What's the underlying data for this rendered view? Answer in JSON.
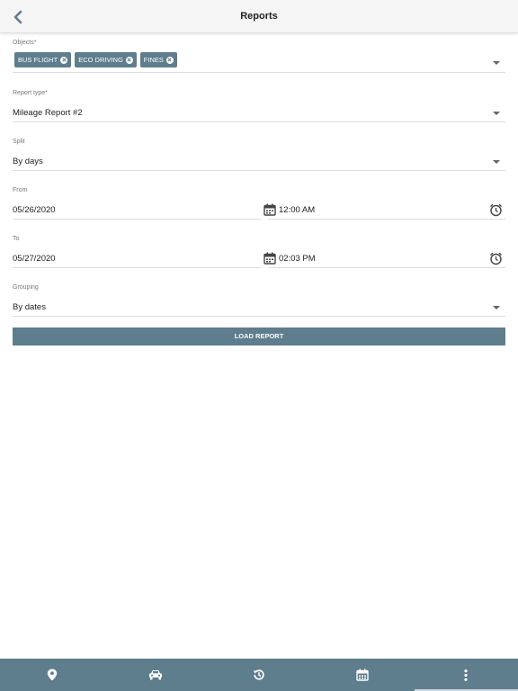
{
  "header": {
    "title": "Reports",
    "back_icon": "chevron-left-icon"
  },
  "objects": {
    "label": "Objects*",
    "chips": [
      "BUS FLIGHT",
      "ECO DRIVING",
      "FINES"
    ]
  },
  "report_type": {
    "label": "Report type*",
    "value": "Mileage Report #2"
  },
  "split": {
    "label": "Split",
    "value": "By days"
  },
  "from": {
    "label": "From",
    "date": "05/26/2020",
    "time": "12:00 AM"
  },
  "to": {
    "label": "To",
    "date": "05/27/2020",
    "time": "02:03 PM"
  },
  "grouping": {
    "label": "Grouping",
    "value": "By dates"
  },
  "load_button": {
    "label": "LOAD REPORT"
  },
  "bottom_nav": {
    "items": [
      "map-pin-icon",
      "car-icon",
      "history-icon",
      "calendar-icon",
      "more-vertical-icon"
    ],
    "active": "more-vertical-icon"
  },
  "colors": {
    "accent": "#5e7d8d",
    "active_indicator": "#c9d6dd",
    "header_bg": "#f5f5f5"
  }
}
